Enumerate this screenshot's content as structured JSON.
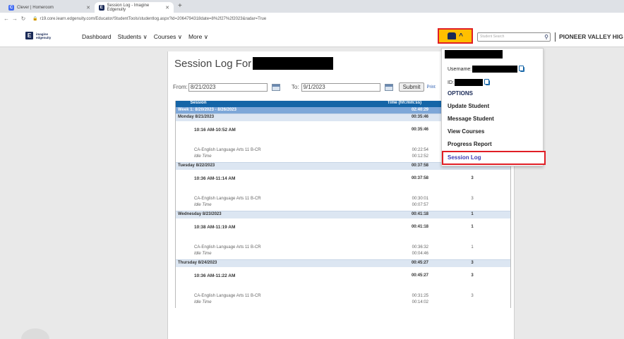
{
  "browser": {
    "tabs": [
      {
        "title": "Clever | Homeroom",
        "favicon": "clever-icon",
        "color": "#436cf2"
      },
      {
        "title": "Session Log - Imagine Edgenuity",
        "favicon": "edgenuity-icon",
        "color": "#1a2a57"
      }
    ],
    "url": "r19.core.learn.edgenuity.com/Educator/StudentTools/studentlog.aspx?id=2064794318date=8%2f27%2f2023&radar=True"
  },
  "nav": {
    "logo_line1": "imagine",
    "logo_line2": "edgenuity",
    "items": [
      "Dashboard",
      "Students ∨",
      "Courses ∨",
      "More ∨"
    ],
    "search_placeholder": "Student Search",
    "school": "PIONEER VALLEY HIG"
  },
  "page": {
    "title": "Session Log For",
    "from_label": "From:",
    "from_value": "8/21/2023",
    "to_label": "To:",
    "to_value": "9/1/2023",
    "submit_label": "Submit",
    "print_label": "Print"
  },
  "table": {
    "headers": {
      "session": "Session",
      "time": "Time (hh:mm:ss)"
    },
    "week": {
      "label": "Week 1: 8/20/2023 - 8/26/2023",
      "time": "02:40:29"
    },
    "days": [
      {
        "label": "Monday 8/21/2023",
        "time": "00:35:46",
        "count": "",
        "slot": "10:16 AM-10:52 AM",
        "slot_time": "00:35:46",
        "slot_count": "2",
        "course": "CA-English Language Arts 11 B-CR",
        "course_time": "00:22:54",
        "course_count": "2",
        "idle": "Idle Time",
        "idle_time": "00:12:52"
      },
      {
        "label": "Tuesday 8/22/2023",
        "time": "00:37:58",
        "count": "3",
        "slot": "10:36 AM-11:14 AM",
        "slot_time": "00:37:58",
        "slot_count": "3",
        "course": "CA-English Language Arts 11 B-CR",
        "course_time": "00:30:01",
        "course_count": "3",
        "idle": "Idle Time",
        "idle_time": "00:07:57"
      },
      {
        "label": "Wednesday 8/23/2023",
        "time": "00:41:18",
        "count": "1",
        "slot": "10:38 AM-11:19 AM",
        "slot_time": "00:41:18",
        "slot_count": "1",
        "course": "CA-English Language Arts 11 B-CR",
        "course_time": "00:36:32",
        "course_count": "1",
        "idle": "Idle Time",
        "idle_time": "00:04:46"
      },
      {
        "label": "Thursday 8/24/2023",
        "time": "00:45:27",
        "count": "3",
        "slot": "10:36 AM-11:22 AM",
        "slot_time": "00:45:27",
        "slot_count": "3",
        "course": "CA-English Language Arts 11 B-CR",
        "course_time": "00:31:25",
        "course_count": "3",
        "idle": "Idle Time",
        "idle_time": "00:14:02"
      }
    ]
  },
  "dropdown": {
    "username_label": "Username:",
    "id_label": "ID:",
    "options_label": "OPTIONS",
    "items": [
      "Update Student",
      "Message Student",
      "View Courses",
      "Progress Report"
    ],
    "active_item": "Session Log"
  },
  "colors": {
    "accent": "#ffbf00",
    "highlight": "#e01e25",
    "header": "#1565a7",
    "week": "#7ea7d8",
    "day": "#dce6f2"
  }
}
